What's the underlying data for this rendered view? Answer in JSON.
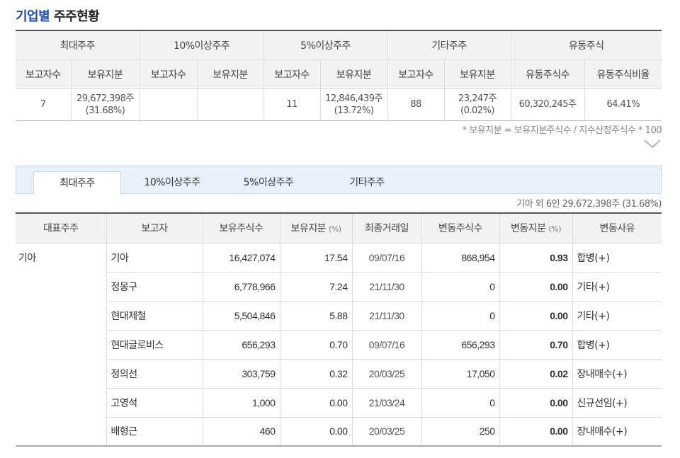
{
  "title": {
    "accent": "기업별",
    "rest": " 주주현황"
  },
  "summary": {
    "groups": [
      "최대주주",
      "10%이상주주",
      "5%이상주주",
      "기타주주",
      "유동주식"
    ],
    "sub_headers": [
      "보고자수",
      "보유지분",
      "보고자수",
      "보유지분",
      "보고자수",
      "보유지분",
      "보고자수",
      "보유지분",
      "유동주식수",
      "유동주식비율"
    ],
    "cells": [
      {
        "line1": "7",
        "line2": ""
      },
      {
        "line1": "29,672,398주",
        "line2": "(31.68%)"
      },
      {
        "line1": "",
        "line2": ""
      },
      {
        "line1": "",
        "line2": ""
      },
      {
        "line1": "11",
        "line2": ""
      },
      {
        "line1": "12,846,439주",
        "line2": "(13.72%)"
      },
      {
        "line1": "88",
        "line2": ""
      },
      {
        "line1": "23,247주",
        "line2": "(0.02%)"
      },
      {
        "line1": "60,320,245주",
        "line2": ""
      },
      {
        "line1": "64.41%",
        "line2": ""
      }
    ]
  },
  "note": "* 보유지분 = 보유지분주식수 / 지수산정주식수 * 100",
  "tabs": [
    "최대주주",
    "10%이상주주",
    "5%이상주주",
    "기타주주"
  ],
  "total_text": "기아 외 6인 29,672,398주 (31.68%)",
  "detail": {
    "headers": [
      "대표주주",
      "보고자",
      "보유주식수",
      "보유지분",
      "최종거래일",
      "변동주식수",
      "변동지분",
      "변동사유"
    ],
    "unit": "(%)",
    "rows": [
      [
        "기아",
        "기아",
        "16,427,074",
        "17.54",
        "09/07/16",
        "868,954",
        "0.93",
        "합병(+)"
      ],
      [
        "",
        "정몽구",
        "6,778,966",
        "7.24",
        "21/11/30",
        "0",
        "0.00",
        "기타(+)"
      ],
      [
        "",
        "현대제철",
        "5,504,846",
        "5.88",
        "21/11/30",
        "0",
        "0.00",
        "기타(+)"
      ],
      [
        "",
        "현대글로비스",
        "656,293",
        "0.70",
        "09/07/16",
        "656,293",
        "0.70",
        "합병(+)"
      ],
      [
        "",
        "정의선",
        "303,759",
        "0.32",
        "20/03/25",
        "17,050",
        "0.02",
        "장내매수(+)"
      ],
      [
        "",
        "고영석",
        "1,000",
        "0.00",
        "21/03/24",
        "0",
        "0.00",
        "신규선임(+)"
      ],
      [
        "",
        "배형근",
        "460",
        "0.00",
        "20/03/25",
        "250",
        "0.00",
        "장내매수(+)"
      ]
    ]
  },
  "icons": {
    "expand": "chevron-down-icon"
  },
  "colors": {
    "accent": "#1f4fb6",
    "tab_bg": "#e9f0fb",
    "header_bg": "#f2f2f2"
  }
}
